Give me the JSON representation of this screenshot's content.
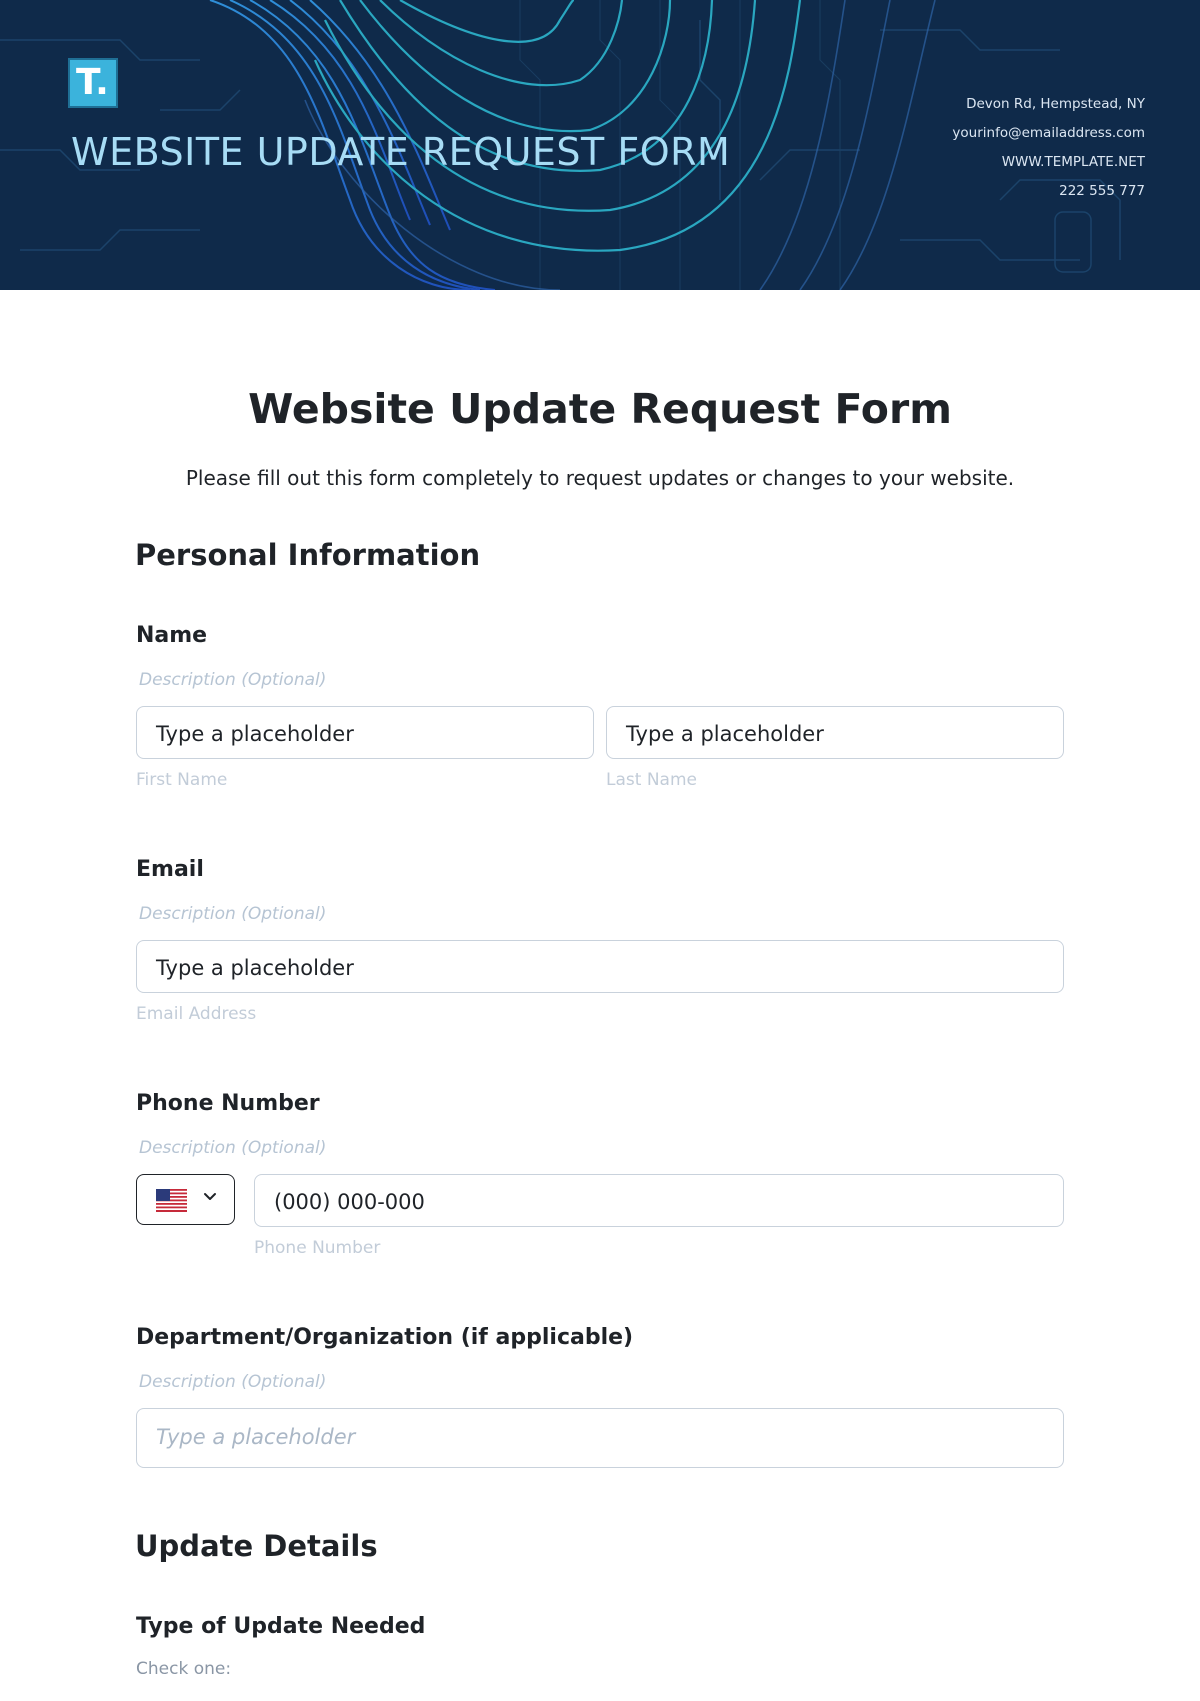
{
  "banner": {
    "logo_text": "T.",
    "title": "WEBSITE UPDATE REQUEST FORM",
    "contact": {
      "address": "Devon Rd, Hempstead, NY",
      "email": "yourinfo@emailaddress.com",
      "website": "WWW.TEMPLATE.NET",
      "phone": "222 555 777"
    }
  },
  "form": {
    "title": "Website Update Request Form",
    "subtitle": "Please fill out this form completely to request updates or changes to your website."
  },
  "sections": {
    "personal": "Personal Information",
    "update": "Update Details"
  },
  "fields": {
    "name": {
      "label": "Name",
      "description": "Description (Optional)",
      "first_value": "Type a placeholder",
      "first_sublabel": "First Name",
      "last_value": "Type a placeholder",
      "last_sublabel": "Last Name"
    },
    "email": {
      "label": "Email",
      "description": "Description (Optional)",
      "value": "Type a placeholder",
      "sublabel": "Email Address"
    },
    "phone": {
      "label": "Phone Number",
      "description": "Description (Optional)",
      "country_icon": "us-flag-icon",
      "value": "(000) 000-000",
      "sublabel": "Phone Number"
    },
    "department": {
      "label": "Department/Organization (if applicable)",
      "description": "Description (Optional)",
      "placeholder": "Type a placeholder"
    },
    "update_type": {
      "label": "Type of Update Needed",
      "hint": "Check one:"
    }
  },
  "colors": {
    "banner_bg": "#0f2a4a",
    "banner_title": "#a7dcf5",
    "logo": "#3bb3dc"
  }
}
